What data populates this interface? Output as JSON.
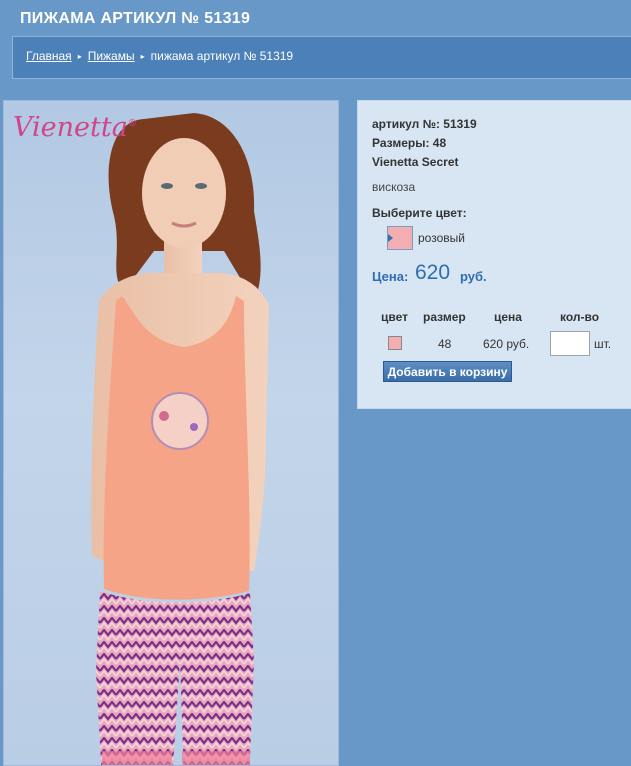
{
  "page": {
    "title": "ПИЖАМА АРТИКУЛ № 51319"
  },
  "breadcrumb": {
    "home": "Главная",
    "category": "Пижамы",
    "current": "пижама артикул № 51319",
    "separator": "▸"
  },
  "product_image": {
    "brand_logo": "Vienetta",
    "brand_mark": "®",
    "description": "photo-of-model-in-pink-tank-top-and-zigzag-capri-pants"
  },
  "product": {
    "article_line": "артикул №: 51319",
    "sizes_line": "Размеры: 48",
    "brand_line": "Vienetta Secret",
    "material": "вискоза",
    "choose_color_label": "Выберите цвет:",
    "color_name": "розовый",
    "color_hex": "#f3aeb1",
    "price_label": "Цена:",
    "price_value": "620",
    "price_unit": "руб."
  },
  "order_table": {
    "headers": {
      "color": "цвет",
      "size": "размер",
      "price": "цена",
      "quantity": "кол-во"
    },
    "row": {
      "size": "48",
      "price": "620 руб.",
      "qty_value": "",
      "unit": "шт."
    }
  },
  "add_to_cart_label": "Добавить в корзину",
  "colors": {
    "background": "#6798c8",
    "breadcrumb_bar": "#4b80b8",
    "panel": "#d8e6f3",
    "price": "#2f6db0",
    "logo": "#d0458c"
  }
}
